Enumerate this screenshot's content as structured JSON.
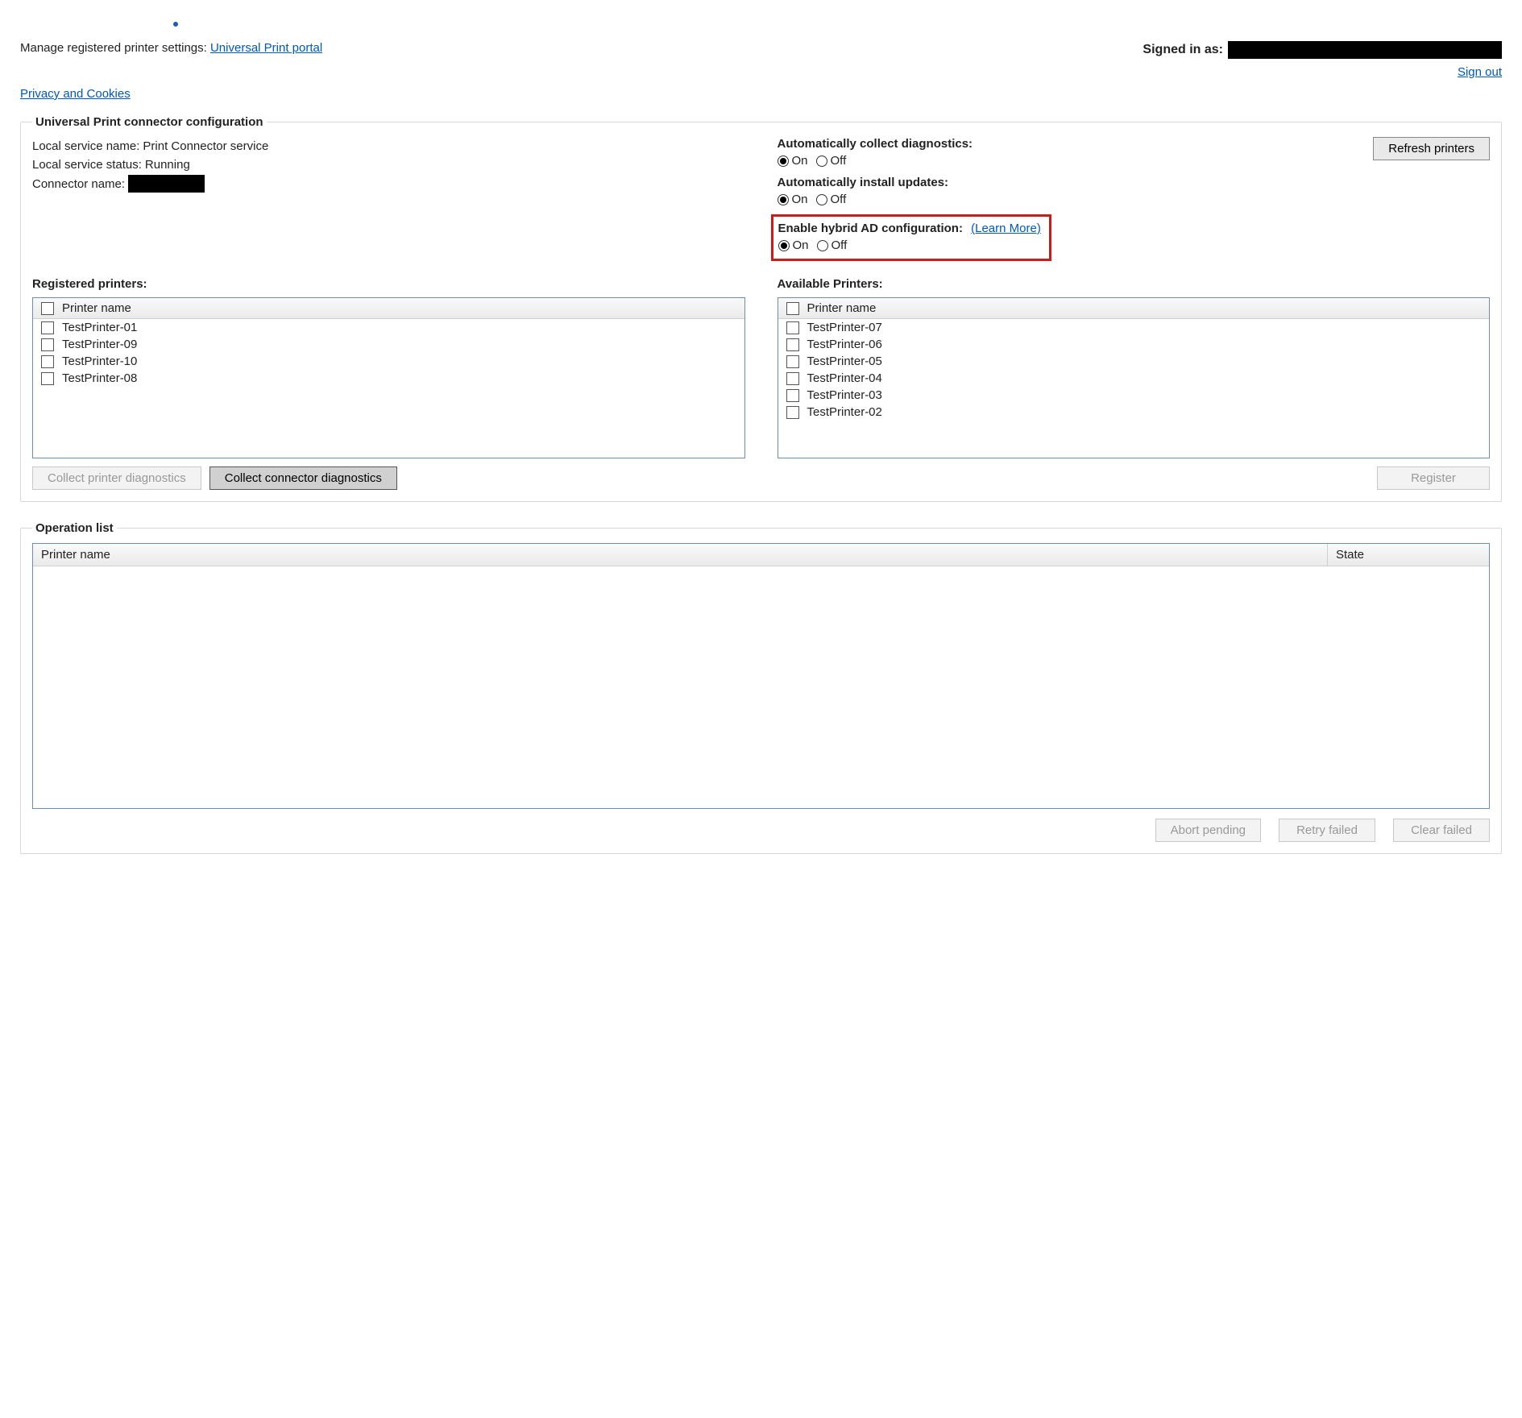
{
  "header": {
    "signed_in_label": "Signed in as:",
    "sign_out": "Sign out",
    "manage_prefix": "Manage registered printer settings: ",
    "portal_link": "Universal Print portal",
    "privacy_link": "Privacy and Cookies"
  },
  "config": {
    "legend": "Universal Print connector configuration",
    "local_service_name_label": "Local service name:",
    "local_service_name_value": "Print Connector service",
    "local_service_status_label": "Local service status:",
    "local_service_status_value": "Running",
    "connector_name_label": "Connector name:",
    "refresh_btn": "Refresh printers",
    "diag_collect_label": "Automatically collect diagnostics:",
    "updates_label": "Automatically install updates:",
    "hybrid_label": "Enable hybrid AD configuration:",
    "learn_more": "(Learn More)",
    "on": "On",
    "off": "Off",
    "diag_collect_value": "On",
    "updates_value": "On",
    "hybrid_value": "On"
  },
  "lists": {
    "registered_title": "Registered printers:",
    "available_title": "Available Printers:",
    "col_printer_name": "Printer name",
    "registered": [
      "TestPrinter-01",
      "TestPrinter-09",
      "TestPrinter-10",
      "TestPrinter-08"
    ],
    "available": [
      "TestPrinter-07",
      "TestPrinter-06",
      "TestPrinter-05",
      "TestPrinter-04",
      "TestPrinter-03",
      "TestPrinter-02"
    ],
    "collect_printer_diag_btn": "Collect printer diagnostics",
    "collect_connector_diag_btn": "Collect connector diagnostics",
    "register_btn": "Register"
  },
  "oplist": {
    "legend": "Operation list",
    "col_printer_name": "Printer name",
    "col_state": "State",
    "abort_btn": "Abort pending",
    "retry_btn": "Retry failed",
    "clear_btn": "Clear failed"
  }
}
